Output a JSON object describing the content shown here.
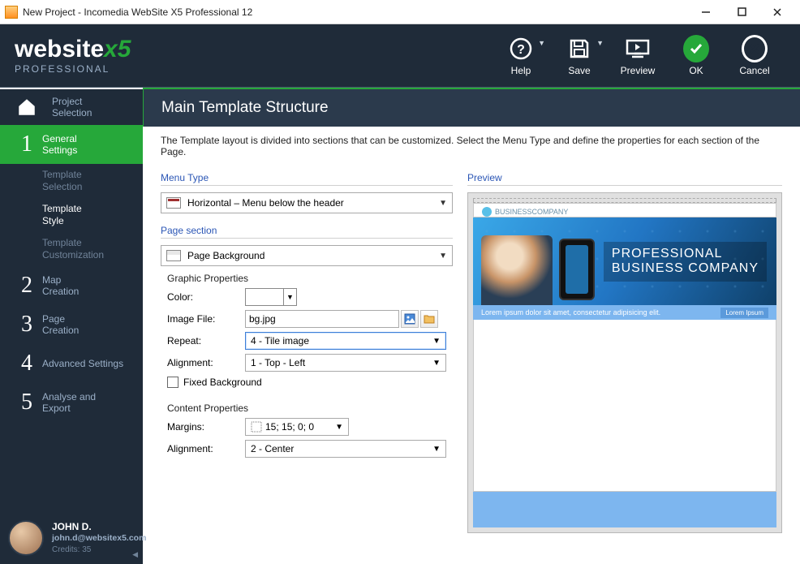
{
  "window": {
    "title": "New Project - Incomedia WebSite X5 Professional 12"
  },
  "header": {
    "logo_main": "website",
    "logo_x5": "x5",
    "logo_sub": "PROFESSIONAL",
    "help": "Help",
    "save": "Save",
    "preview": "Preview",
    "ok": "OK",
    "cancel": "Cancel"
  },
  "nav": {
    "project_selection": "Project\nSelection",
    "steps": [
      {
        "num": "1",
        "label": "General\nSettings"
      },
      {
        "num": "2",
        "label": "Map\nCreation"
      },
      {
        "num": "3",
        "label": "Page\nCreation"
      },
      {
        "num": "4",
        "label": "Advanced Settings"
      },
      {
        "num": "5",
        "label": "Analyse and\nExport"
      }
    ],
    "subs": [
      "Template\nSelection",
      "Template\nStyle",
      "Template\nCustomization"
    ]
  },
  "user": {
    "name": "JOHN D.",
    "email": "john.d@websitex5.com",
    "credits": "Credits: 35"
  },
  "page": {
    "title": "Main Template Structure",
    "desc": "The Template layout is divided into sections that can be customized. Select the Menu Type and define the properties for each section of the Page.",
    "menu_type_lbl": "Menu Type",
    "menu_type_val": "Horizontal – Menu below the header",
    "page_section_lbl": "Page section",
    "page_section_val": "Page Background",
    "graphic_props": "Graphic Properties",
    "color_lbl": "Color:",
    "image_lbl": "Image File:",
    "image_val": "bg.jpg",
    "repeat_lbl": "Repeat:",
    "repeat_val": "4 - Tile image",
    "align_lbl": "Alignment:",
    "align_val": "1 - Top - Left",
    "fixed_bg": "Fixed Background",
    "content_props": "Content Properties",
    "margins_lbl": "Margins:",
    "margins_val": "15; 15; 0; 0",
    "calign_lbl": "Alignment:",
    "calign_val": "2 - Center",
    "preview_lbl": "Preview"
  },
  "preview": {
    "logo_text": "BUSINESSCOMPANY",
    "title_l1": "PROFESSIONAL",
    "title_l2": "BUSINESS COMPANY",
    "subtext": "Lorem ipsum dolor sit amet, consectetur adipisicing elit.",
    "subbtn": "Lorem Ipsum"
  }
}
